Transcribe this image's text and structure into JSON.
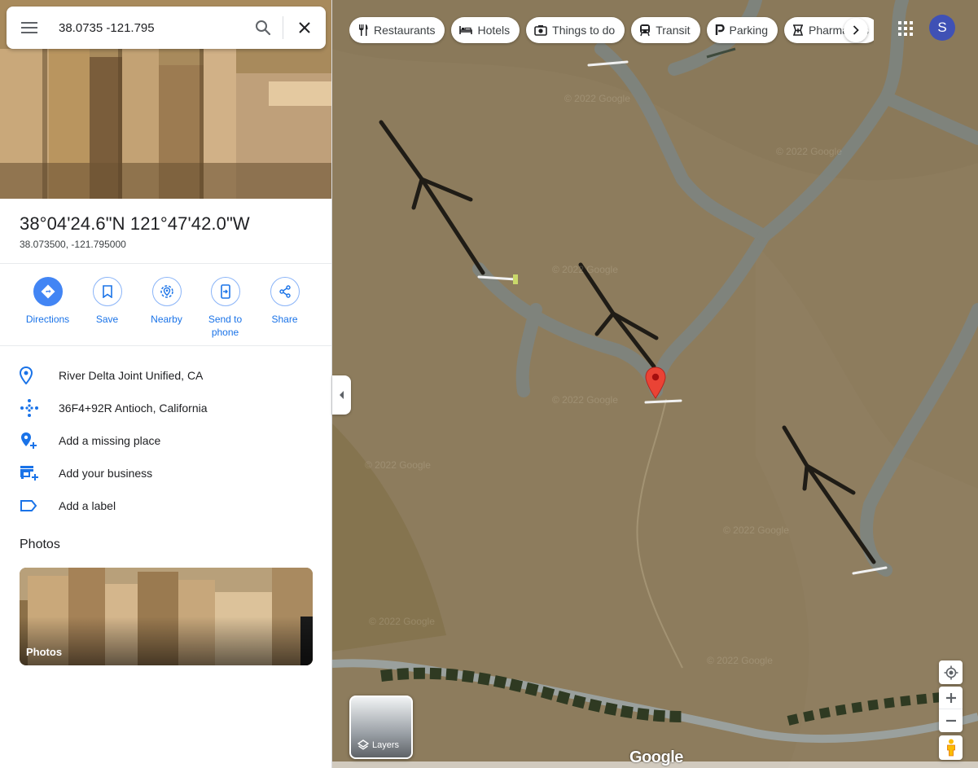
{
  "search": {
    "value": "38.0735 -121.795",
    "menu_icon": "hamburger-menu-icon",
    "search_icon": "search-icon",
    "close_icon": "close-icon"
  },
  "place": {
    "title": "38°04'24.6\"N 121°47'42.0\"W",
    "coordinates": "38.073500, -121.795000"
  },
  "actions": [
    {
      "label": "Directions",
      "icon": "directions-icon"
    },
    {
      "label": "Save",
      "icon": "bookmark-icon"
    },
    {
      "label": "Nearby",
      "icon": "nearby-icon"
    },
    {
      "label": "Send to phone",
      "icon": "send-to-phone-icon"
    },
    {
      "label": "Share",
      "icon": "share-icon"
    }
  ],
  "info": [
    {
      "text": "River Delta Joint Unified, CA",
      "icon": "location-pin-icon"
    },
    {
      "text": "36F4+92R Antioch, California",
      "icon": "plus-code-icon"
    },
    {
      "text": "Add a missing place",
      "icon": "add-place-icon"
    },
    {
      "text": "Add your business",
      "icon": "add-business-icon"
    },
    {
      "text": "Add a label",
      "icon": "label-icon"
    }
  ],
  "photos": {
    "heading": "Photos",
    "card_label": "Photos"
  },
  "chips": [
    {
      "label": "Restaurants",
      "icon": "restaurant-icon"
    },
    {
      "label": "Hotels",
      "icon": "hotel-icon"
    },
    {
      "label": "Things to do",
      "icon": "camera-icon"
    },
    {
      "label": "Transit",
      "icon": "transit-icon"
    },
    {
      "label": "Parking",
      "icon": "parking-icon"
    },
    {
      "label": "Pharmacies",
      "icon": "pharmacy-icon"
    }
  ],
  "map": {
    "layers_label": "Layers",
    "brand": "Google",
    "avatar_letter": "S",
    "watermark": "© 2022 Google"
  },
  "colors": {
    "accent": "#1a73e8",
    "directions_fill": "#4285f4",
    "pin": "#ea4335",
    "avatar": "#3f51b5"
  }
}
